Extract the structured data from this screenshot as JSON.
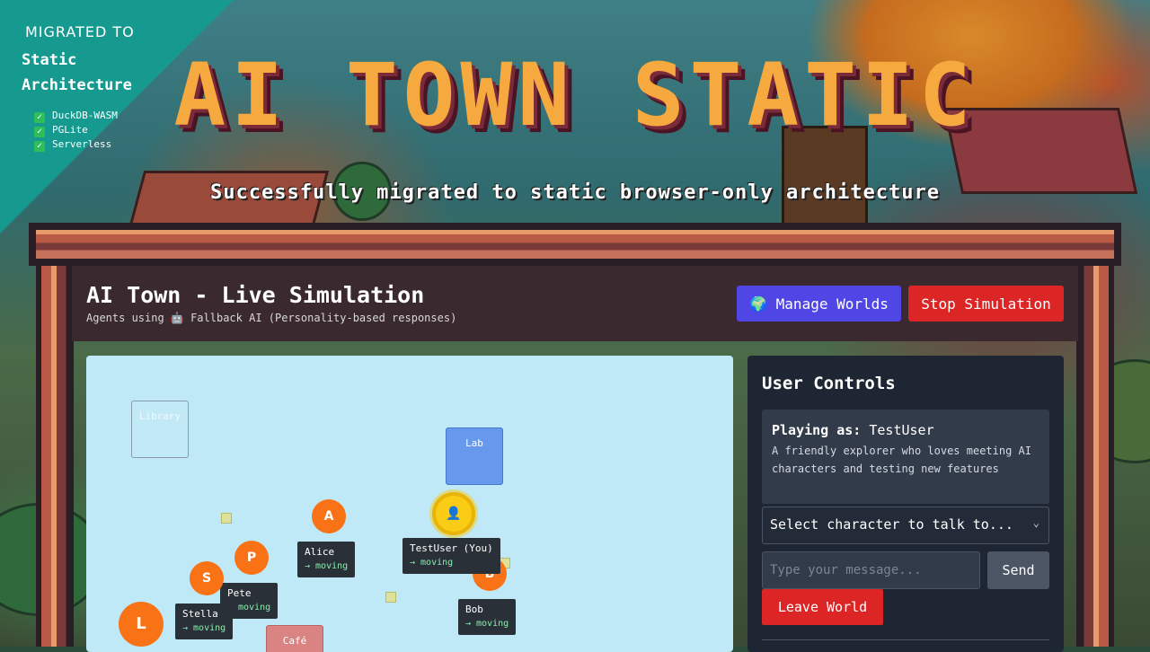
{
  "banner": {
    "heading": "MIGRATED TO",
    "line1": "Static",
    "line2": "Architecture",
    "items": [
      "DuckDB-WASM",
      "PGLite",
      "Serverless"
    ]
  },
  "hero": {
    "title": "AI TOWN STATIC",
    "subtitle": "Successfully migrated to static browser-only architecture"
  },
  "app": {
    "title": "AI Town - Live Simulation",
    "subtitle": "Agents using 🤖 Fallback AI (Personality-based responses)",
    "manage_worlds": "🌍 Manage Worlds",
    "stop_simulation": "Stop Simulation"
  },
  "map": {
    "buildings": {
      "library": "Library",
      "lab": "Lab",
      "cafe": "Café"
    },
    "agents": [
      {
        "initial": "A",
        "name": "Alice",
        "status": "→ moving"
      },
      {
        "initial": "P",
        "name": "Pete",
        "status": "→ moving"
      },
      {
        "initial": "S",
        "name": "Stella",
        "status": "→ moving"
      },
      {
        "initial": "L",
        "name": "",
        "status": ""
      },
      {
        "initial": "B",
        "name": "Bob",
        "status": "→ moving"
      }
    ],
    "user": {
      "icon": "👤",
      "name": "TestUser (You)",
      "status": "→ moving"
    }
  },
  "controls": {
    "title": "User Controls",
    "playing_label": "Playing as:",
    "playing_name": "TestUser",
    "playing_desc": "A friendly explorer who loves meeting AI characters and testing new features",
    "select_placeholder": "Select character to talk to...",
    "message_placeholder": "Type your message...",
    "send": "Send",
    "leave": "Leave World"
  }
}
